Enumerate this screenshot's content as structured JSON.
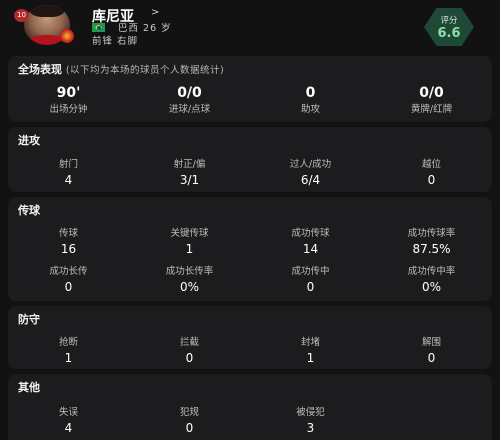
{
  "player": {
    "number": "10",
    "name": "库尼亚",
    "chevron": ">",
    "nationality_age": "巴西 26 岁",
    "position_foot": "前锋  右脚",
    "flag": "brazil-flag",
    "club_crest": "manchester-united-crest"
  },
  "rating": {
    "label": "评分",
    "value": "6.6",
    "color": "#8ce0a8"
  },
  "overall": {
    "title": "全场表现",
    "subtitle": "(以下均为本场的球员个人数据统计)",
    "stats": [
      {
        "value": "90'",
        "label": "出场分钟"
      },
      {
        "value": "0/0",
        "label": "进球/点球"
      },
      {
        "value": "0",
        "label": "助攻"
      },
      {
        "value": "0/0",
        "label": "黄牌/红牌"
      }
    ]
  },
  "attack": {
    "title": "进攻",
    "stats": [
      {
        "label": "射门",
        "value": "4"
      },
      {
        "label": "射正/偏",
        "value": "3/1"
      },
      {
        "label": "过人/成功",
        "value": "6/4"
      },
      {
        "label": "越位",
        "value": "0"
      }
    ]
  },
  "passing": {
    "title": "传球",
    "rows": [
      [
        {
          "label": "传球",
          "value": "16"
        },
        {
          "label": "关键传球",
          "value": "1"
        },
        {
          "label": "成功传球",
          "value": "14"
        },
        {
          "label": "成功传球率",
          "value": "87.5%"
        }
      ],
      [
        {
          "label": "成功长传",
          "value": "0"
        },
        {
          "label": "成功长传率",
          "value": "0%"
        },
        {
          "label": "成功传中",
          "value": "0"
        },
        {
          "label": "成功传中率",
          "value": "0%"
        }
      ]
    ]
  },
  "defense": {
    "title": "防守",
    "stats": [
      {
        "label": "抢断",
        "value": "1"
      },
      {
        "label": "拦截",
        "value": "0"
      },
      {
        "label": "封堵",
        "value": "1"
      },
      {
        "label": "解围",
        "value": "0"
      }
    ]
  },
  "other": {
    "title": "其他",
    "stats": [
      {
        "label": "失误",
        "value": "4"
      },
      {
        "label": "犯规",
        "value": "0"
      },
      {
        "label": "被侵犯",
        "value": "3"
      }
    ]
  }
}
